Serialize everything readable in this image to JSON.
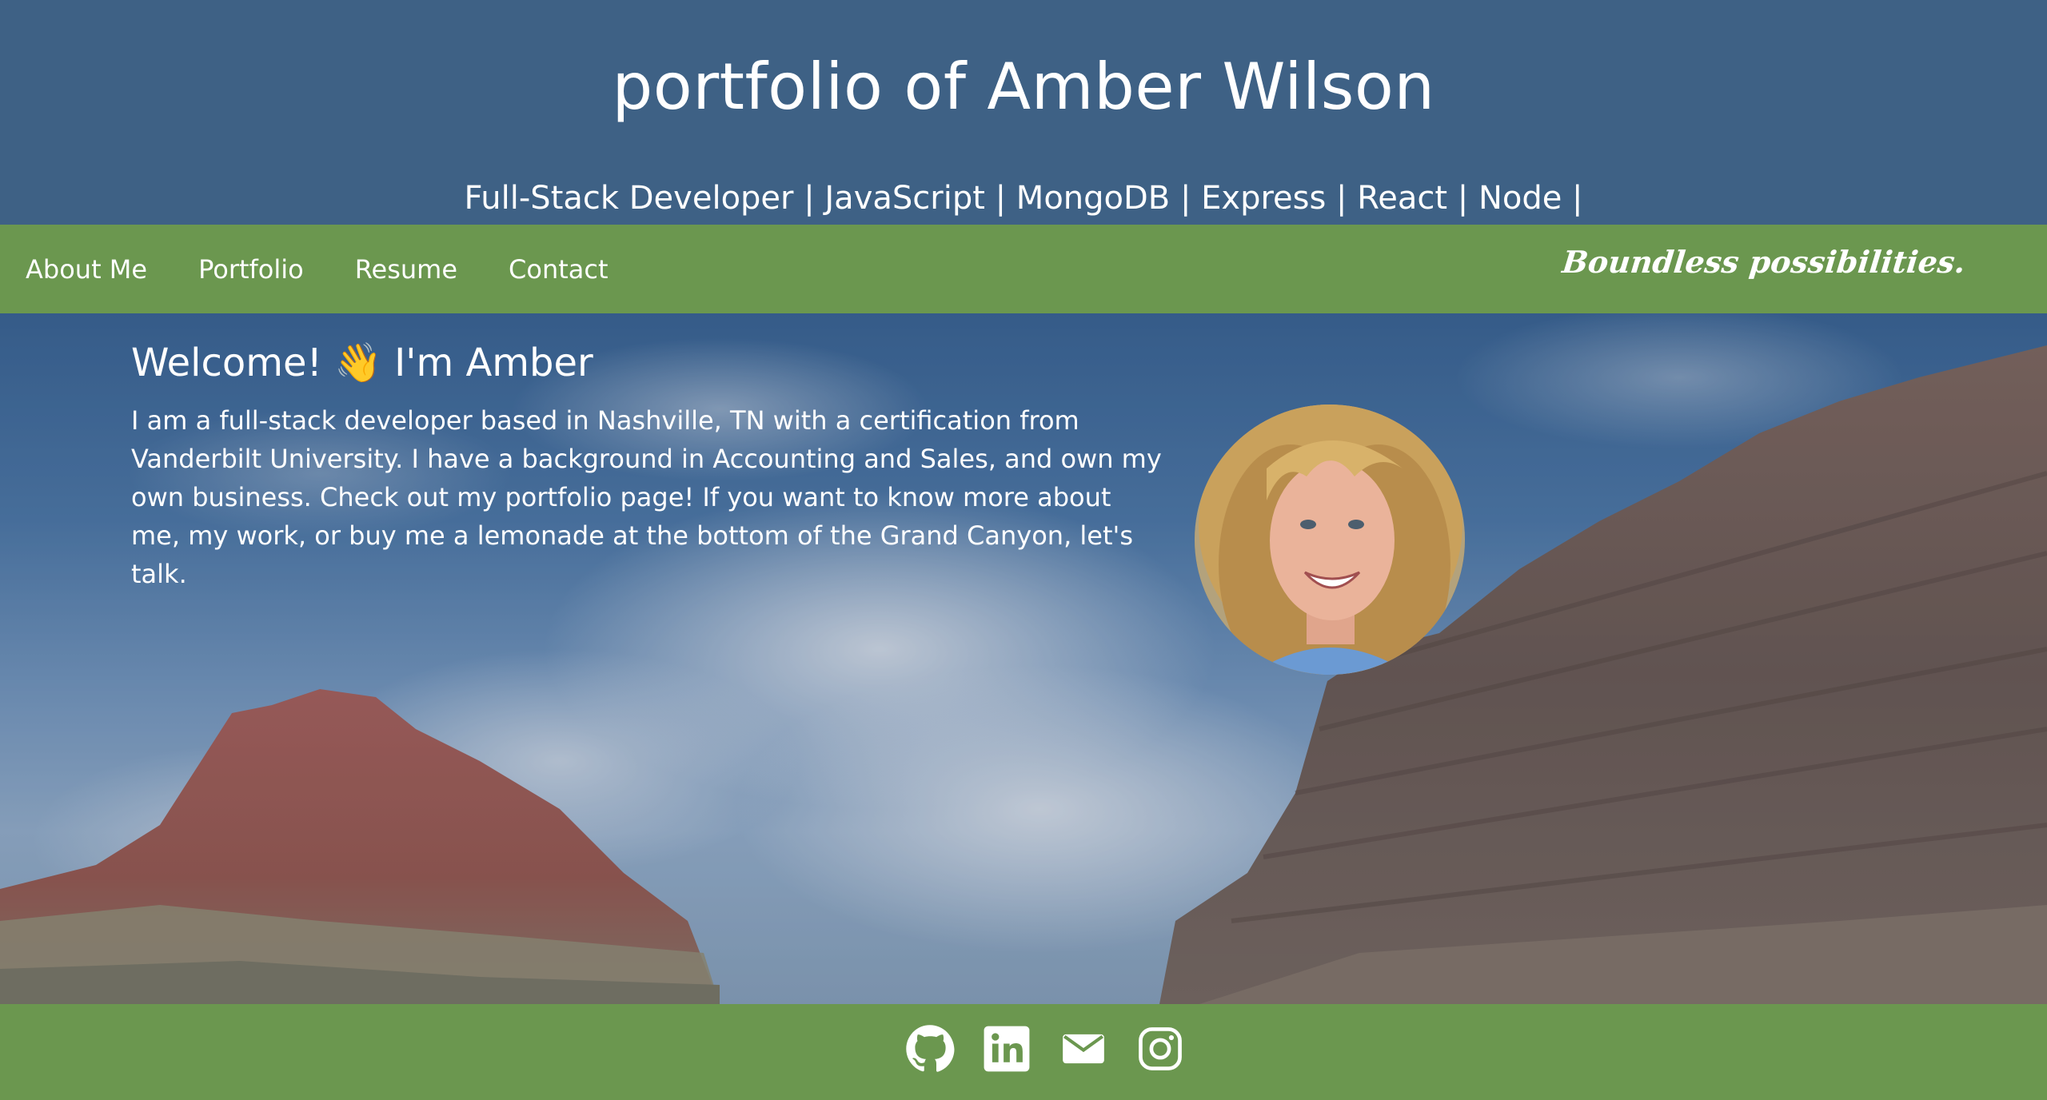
{
  "header": {
    "title": "portfolio of Amber Wilson",
    "subtitle": "Full-Stack Developer | JavaScript | MongoDB | Express | React | Node |"
  },
  "nav": {
    "items": [
      {
        "label": "About Me"
      },
      {
        "label": "Portfolio"
      },
      {
        "label": "Resume"
      },
      {
        "label": "Contact"
      }
    ],
    "tagline": "Boundless possibilities."
  },
  "hero": {
    "heading": "Welcome! 👋 I'm Amber",
    "bio": "I am a full-stack developer based in Nashville, TN with a certification from Vanderbilt University. I have a background in Accounting and Sales, and own my own business. Check out my portfolio page! If you want to know more about me, my work, or buy me a lemonade at the bottom of the Grand Canyon, let's talk.",
    "background_icon": "grand-canyon-photo",
    "avatar_icon": "profile-photo"
  },
  "footer": {
    "social": [
      {
        "icon": "github-icon"
      },
      {
        "icon": "linkedin-icon"
      },
      {
        "icon": "email-icon"
      },
      {
        "icon": "instagram-icon"
      }
    ]
  },
  "colors": {
    "header_bg": "#3e6185",
    "nav_bg": "#6b974f",
    "footer_bg": "#6b974f",
    "text": "#ffffff"
  }
}
